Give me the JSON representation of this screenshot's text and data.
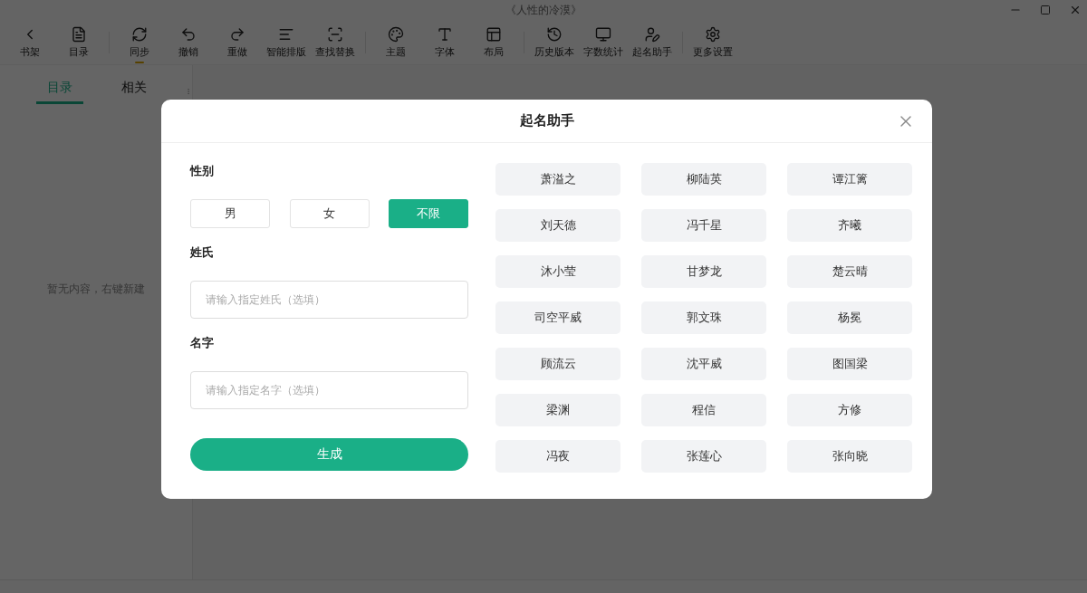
{
  "window": {
    "title": "《人性的冷漠》"
  },
  "toolbar": {
    "groups": [
      [
        "书架",
        "目录"
      ],
      [
        "同步",
        "撤销",
        "重做",
        "智能排版",
        "查找替换"
      ],
      [
        "主题",
        "字体",
        "布局"
      ],
      [
        "历史版本",
        "字数统计",
        "起名助手"
      ],
      [
        "更多设置"
      ]
    ]
  },
  "sidebar": {
    "tabs": [
      {
        "label": "目录",
        "selected": true
      },
      {
        "label": "相关",
        "selected": false
      }
    ],
    "empty_text": "暂无内容，右键新建"
  },
  "dialog": {
    "title": "起名助手",
    "gender": {
      "label": "性别",
      "options": [
        {
          "label": "男",
          "selected": false
        },
        {
          "label": "女",
          "selected": false
        },
        {
          "label": "不限",
          "selected": true
        }
      ]
    },
    "surname": {
      "label": "姓氏",
      "placeholder": "请输入指定姓氏（选填）"
    },
    "given_name": {
      "label": "名字",
      "placeholder": "请输入指定名字（选填）"
    },
    "generate_button": "生成",
    "names": [
      "萧溢之",
      "柳陆英",
      "谭江篱",
      "刘天德",
      "冯千星",
      "齐曦",
      "沐小莹",
      "甘梦龙",
      "楚云晴",
      "司空平威",
      "郭文珠",
      "杨冕",
      "顾流云",
      "沈平威",
      "图国梁",
      "梁渊",
      "程信",
      "方修",
      "冯夜",
      "张莲心",
      "张向晓"
    ]
  }
}
